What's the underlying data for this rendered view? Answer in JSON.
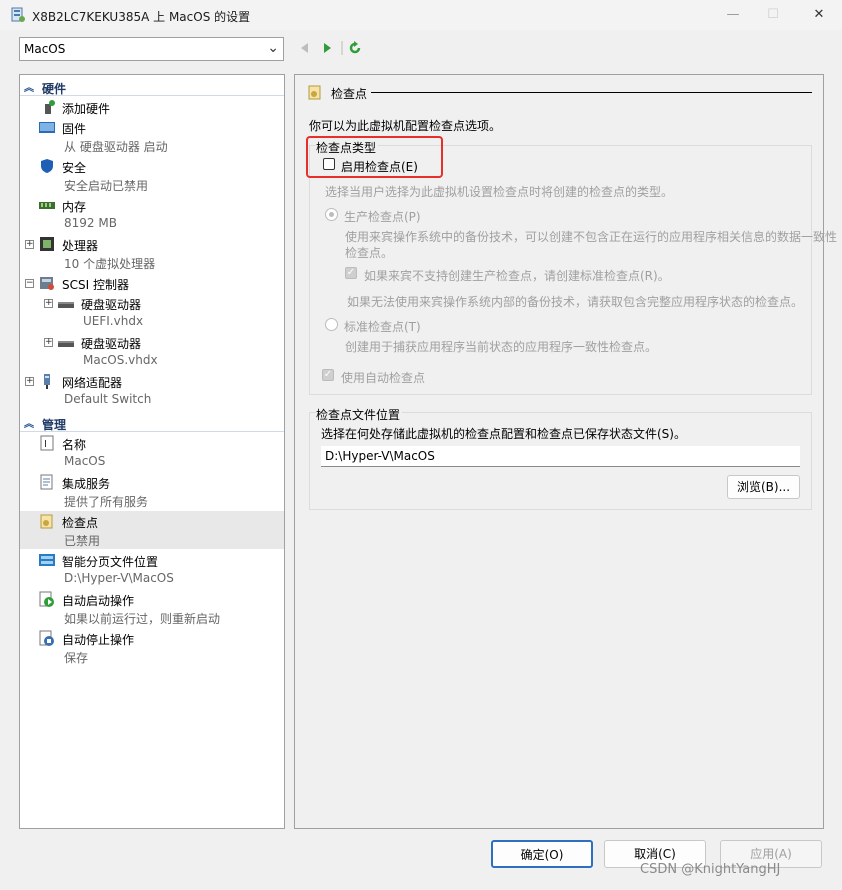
{
  "window": {
    "title": "X8B2LC7KEKU385A 上 MacOS 的设置",
    "minimize": "—",
    "maximize": "☐",
    "close": "✕"
  },
  "toolbar": {
    "vm_selected": "MacOS"
  },
  "sidebar": {
    "hardware_header": "硬件",
    "management_header": "管理",
    "hardware_items": [
      {
        "name": "添加硬件",
        "sub": ""
      },
      {
        "name": "固件",
        "sub": "从 硬盘驱动器 启动"
      },
      {
        "name": "安全",
        "sub": "安全启动已禁用"
      },
      {
        "name": "内存",
        "sub": "8192 MB"
      },
      {
        "name": "处理器",
        "sub": "10 个虚拟处理器"
      },
      {
        "name": "SCSI 控制器",
        "sub": ""
      },
      {
        "name": "硬盘驱动器",
        "sub": "UEFI.vhdx"
      },
      {
        "name": "硬盘驱动器",
        "sub": "MacOS.vhdx"
      },
      {
        "name": "网络适配器",
        "sub": "Default Switch"
      }
    ],
    "management_items": [
      {
        "name": "名称",
        "sub": "MacOS"
      },
      {
        "name": "集成服务",
        "sub": "提供了所有服务"
      },
      {
        "name": "检查点",
        "sub": "已禁用"
      },
      {
        "name": "智能分页文件位置",
        "sub": "D:\\Hyper-V\\MacOS"
      },
      {
        "name": "自动启动操作",
        "sub": "如果以前运行过，则重新启动"
      },
      {
        "name": "自动停止操作",
        "sub": "保存"
      }
    ]
  },
  "panel": {
    "header": "检查点",
    "intro": "你可以为此虚拟机配置检查点选项。",
    "type_group_label": "检查点类型",
    "enable_checkpoints": "启用检查点(E)",
    "type_hint": "选择当用户选择为此虚拟机设置检查点时将创建的检查点的类型。",
    "production_label": "生产检查点(P)",
    "production_desc_1": "使用来宾操作系统中的备份技术，可以创建不包含正在运行的应用程序相关信息的数据一致性",
    "production_desc_2": "检查点。",
    "fallback_standard": "如果来宾不支持创建生产检查点，请创建标准检查点(R)。",
    "fallback_note": "如果无法使用来宾操作系统内部的备份技术，请获取包含完整应用程序状态的检查点。",
    "standard_label": "标准检查点(T)",
    "standard_desc": "创建用于捕获应用程序当前状态的应用程序一致性检查点。",
    "auto_checkpoint": "使用自动检查点",
    "location_group_label": "检查点文件位置",
    "location_desc": "选择在何处存储此虚拟机的检查点配置和检查点已保存状态文件(S)。",
    "location_path": "D:\\Hyper-V\\MacOS",
    "browse": "浏览(B)..."
  },
  "footer": {
    "ok": "确定(O)",
    "cancel": "取消(C)",
    "apply": "应用(A)"
  },
  "watermark": "CSDN @KnightYangHJ"
}
